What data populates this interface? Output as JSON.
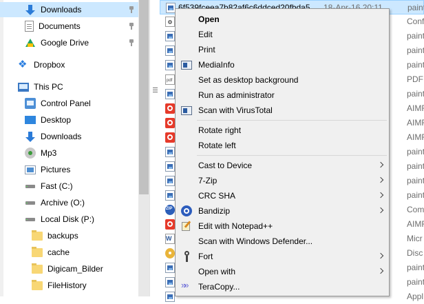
{
  "nav": {
    "items": [
      {
        "label": "Downloads",
        "icon": "download-icon",
        "pinned": true,
        "selected": true
      },
      {
        "label": "Documents",
        "icon": "document-icon",
        "pinned": true
      },
      {
        "label": "Google Drive",
        "icon": "google-drive-icon",
        "pinned": true
      },
      {
        "label": "Dropbox",
        "icon": "dropbox-icon"
      },
      {
        "label": "This PC",
        "icon": "computer-icon"
      },
      {
        "label": "Control Panel",
        "icon": "control-panel-icon"
      },
      {
        "label": "Desktop",
        "icon": "desktop-icon"
      },
      {
        "label": "Downloads",
        "icon": "download-icon"
      },
      {
        "label": "Mp3",
        "icon": "music-icon"
      },
      {
        "label": "Pictures",
        "icon": "pictures-icon"
      },
      {
        "label": "Fast (C:)",
        "icon": "drive-icon"
      },
      {
        "label": "Archive (O:)",
        "icon": "drive-icon"
      },
      {
        "label": "Local Disk (P:)",
        "icon": "drive-icon"
      },
      {
        "label": "backups",
        "icon": "folder-icon"
      },
      {
        "label": "cache",
        "icon": "folder-icon"
      },
      {
        "label": "Digicam_Bilder",
        "icon": "folder-icon"
      },
      {
        "label": "FileHistory",
        "icon": "folder-icon"
      }
    ]
  },
  "files": {
    "selected": {
      "name": "6f539fceea7b82af6c6ddced20fbda5",
      "date": "18-Apr-16 20:11",
      "type": "paint"
    },
    "types": [
      "Conf",
      "paint",
      "paint",
      "paint",
      "PDF",
      "paint",
      "AIMF",
      "AIMF",
      "AIMF",
      "paint",
      "paint",
      "paint",
      "paint",
      "Com",
      "AIMF",
      "Micr",
      "Disc",
      "paint",
      "paint",
      "Appl"
    ],
    "icons": [
      "config-file-icon",
      "image-file-icon",
      "image-file-icon",
      "image-file-icon",
      "pdf-file-icon",
      "image-file-icon",
      "aimp-file-icon",
      "aimp-file-icon",
      "aimp-file-icon",
      "image-file-icon",
      "image-file-icon",
      "image-file-icon",
      "image-file-icon",
      "archive-file-icon",
      "aimp-file-icon",
      "word-file-icon",
      "disc-file-icon",
      "image-file-icon",
      "image-file-icon",
      "image-file-icon"
    ]
  },
  "menu": {
    "open": "Open",
    "edit": "Edit",
    "print": "Print",
    "mediainfo": "MediaInfo",
    "set_desktop_bg": "Set as desktop background",
    "run_as_admin": "Run as administrator",
    "scan_virustotal": "Scan with VirusTotal",
    "rotate_right": "Rotate right",
    "rotate_left": "Rotate left",
    "cast_to_device": "Cast to Device",
    "seven_zip": "7-Zip",
    "crc_sha": "CRC SHA",
    "bandizip": "Bandizip",
    "edit_notepadpp": "Edit with Notepad++",
    "scan_defender": "Scan with Windows Defender...",
    "fort": "Fort",
    "open_with": "Open with",
    "teracopy": "TeraCopy..."
  },
  "colors": {
    "selection": "#cce8ff",
    "menu_bg": "#f0f0f0",
    "accent": "#2b7bd8"
  }
}
